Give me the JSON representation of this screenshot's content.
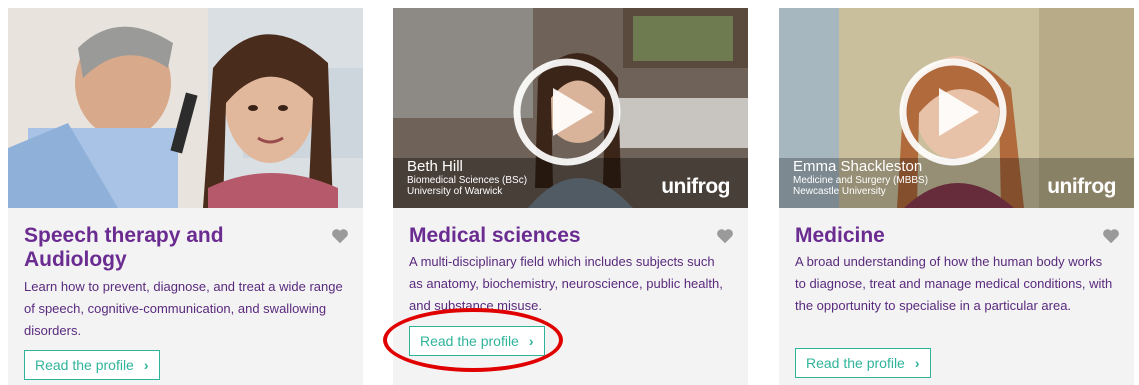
{
  "cards": [
    {
      "title": "Speech therapy and Audiology",
      "description": "Learn how to prevent, diagnose, and treat a wide range of speech, cognitive-communication, and swallowing disorders.",
      "button": "Read the profile",
      "has_video": false
    },
    {
      "title": "Medical sciences",
      "description": "A multi-disciplinary field which includes subjects such as anatomy, biochemistry, neuroscience, public health, and substance misuse.",
      "button": "Read the profile",
      "has_video": true,
      "overlay": {
        "name": "Beth Hill",
        "course": "Biomedical Sciences (BSc)",
        "university": "University of Warwick",
        "brand": "unifrog"
      }
    },
    {
      "title": "Medicine",
      "description": "A broad understanding of how the human body works to diagnose, treat and manage medical conditions, with the opportunity to specialise in a particular area.",
      "button": "Read the profile",
      "has_video": true,
      "overlay": {
        "name": "Emma Shackleston",
        "course": "Medicine and Surgery (MBBS)",
        "university": "Newcastle University",
        "brand": "unifrog"
      }
    }
  ],
  "colors": {
    "title": "#6a2c91",
    "accent": "#2fb49a",
    "card_bg": "#f3f3f3",
    "highlight": "#e10000"
  },
  "icons": {
    "favorite": "heart-icon",
    "play": "play-icon",
    "chevron": "chevron-right-icon"
  }
}
